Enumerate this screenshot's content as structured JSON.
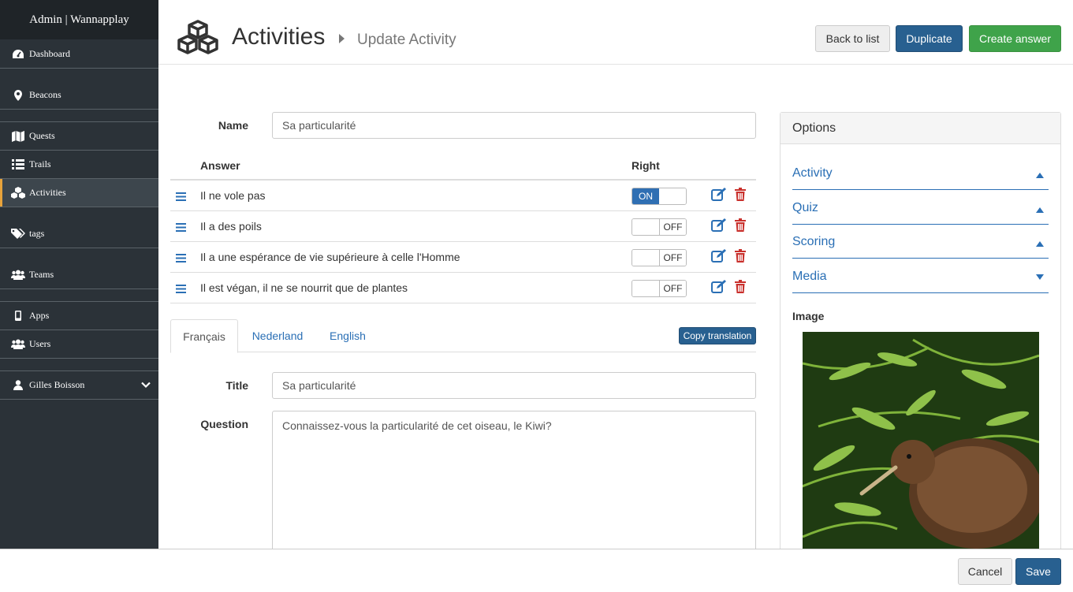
{
  "sidebar": {
    "brand": "Admin | Wannapplay",
    "items": [
      {
        "label": "Dashboard"
      },
      {
        "label": "Beacons"
      },
      {
        "label": "Quests"
      },
      {
        "label": "Trails"
      },
      {
        "label": "Activities"
      },
      {
        "label": "tags"
      },
      {
        "label": "Teams"
      },
      {
        "label": "Apps"
      },
      {
        "label": "Users"
      },
      {
        "label": "Gilles Boisson"
      }
    ],
    "active_item": "Activities",
    "accent_color": "#e8a33b"
  },
  "header": {
    "title": "Activities",
    "breadcrumb": "Update Activity",
    "back_label": "Back to list",
    "duplicate_label": "Duplicate",
    "create_answer_label": "Create answer"
  },
  "form": {
    "name_label": "Name",
    "name_value": "Sa particularité",
    "answers_header": "Answer",
    "right_header": "Right",
    "answers": [
      {
        "text": "Il ne vole pas",
        "right": "ON"
      },
      {
        "text": "Il a des poils",
        "right": "OFF"
      },
      {
        "text": "Il a une espérance de vie supérieure à celle l'Homme",
        "right": "OFF"
      },
      {
        "text": "Il est végan, il ne se nourrit que de plantes",
        "right": "OFF"
      }
    ],
    "tabs": [
      "Français",
      "Nederland",
      "English"
    ],
    "active_tab": "Français",
    "copy_translation_label": "Copy translation",
    "title_label": "Title",
    "title_value": "Sa particularité",
    "question_label": "Question",
    "question_value": "Connaissez-vous la particularité de cet oiseau, le Kiwi?"
  },
  "options": {
    "heading": "Options",
    "sections": [
      {
        "label": "Activity",
        "state": "up"
      },
      {
        "label": "Quiz",
        "state": "up"
      },
      {
        "label": "Scoring",
        "state": "up"
      },
      {
        "label": "Media",
        "state": "down"
      }
    ],
    "image_label": "Image"
  },
  "footer": {
    "cancel_label": "Cancel",
    "save_label": "Save"
  }
}
